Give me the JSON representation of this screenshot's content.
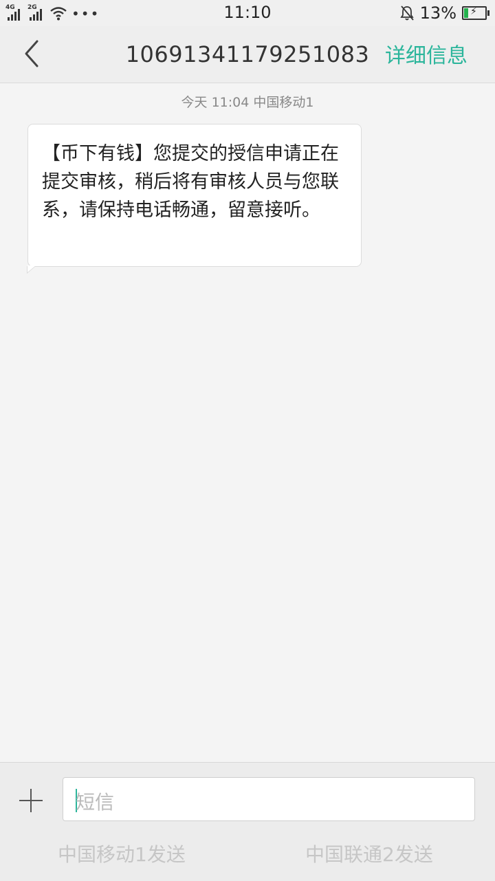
{
  "status_bar": {
    "sim1_network": "4G",
    "sim2_network": "2G",
    "more": "•••",
    "time": "11:10",
    "battery_percent": "13%",
    "battery_level": 0.13,
    "battery_color": "#23b14d"
  },
  "header": {
    "back_icon": "chevron-left-icon",
    "title": "10691341179251083",
    "details_label": "详细信息",
    "accent_color": "#2bb59b"
  },
  "conversation": {
    "timestamp": "今天  11:04  中国移动1",
    "messages": [
      {
        "direction": "incoming",
        "text": "【币下有钱】您提交的授信申请正在提交审核，稍后将有审核人员与您联系，请保持电话畅通，留意接听。"
      }
    ]
  },
  "composer": {
    "add_icon": "plus-icon",
    "placeholder": "短信",
    "value": "",
    "send_sim1": "中国移动1发送",
    "send_sim2": "中国联通2发送"
  }
}
